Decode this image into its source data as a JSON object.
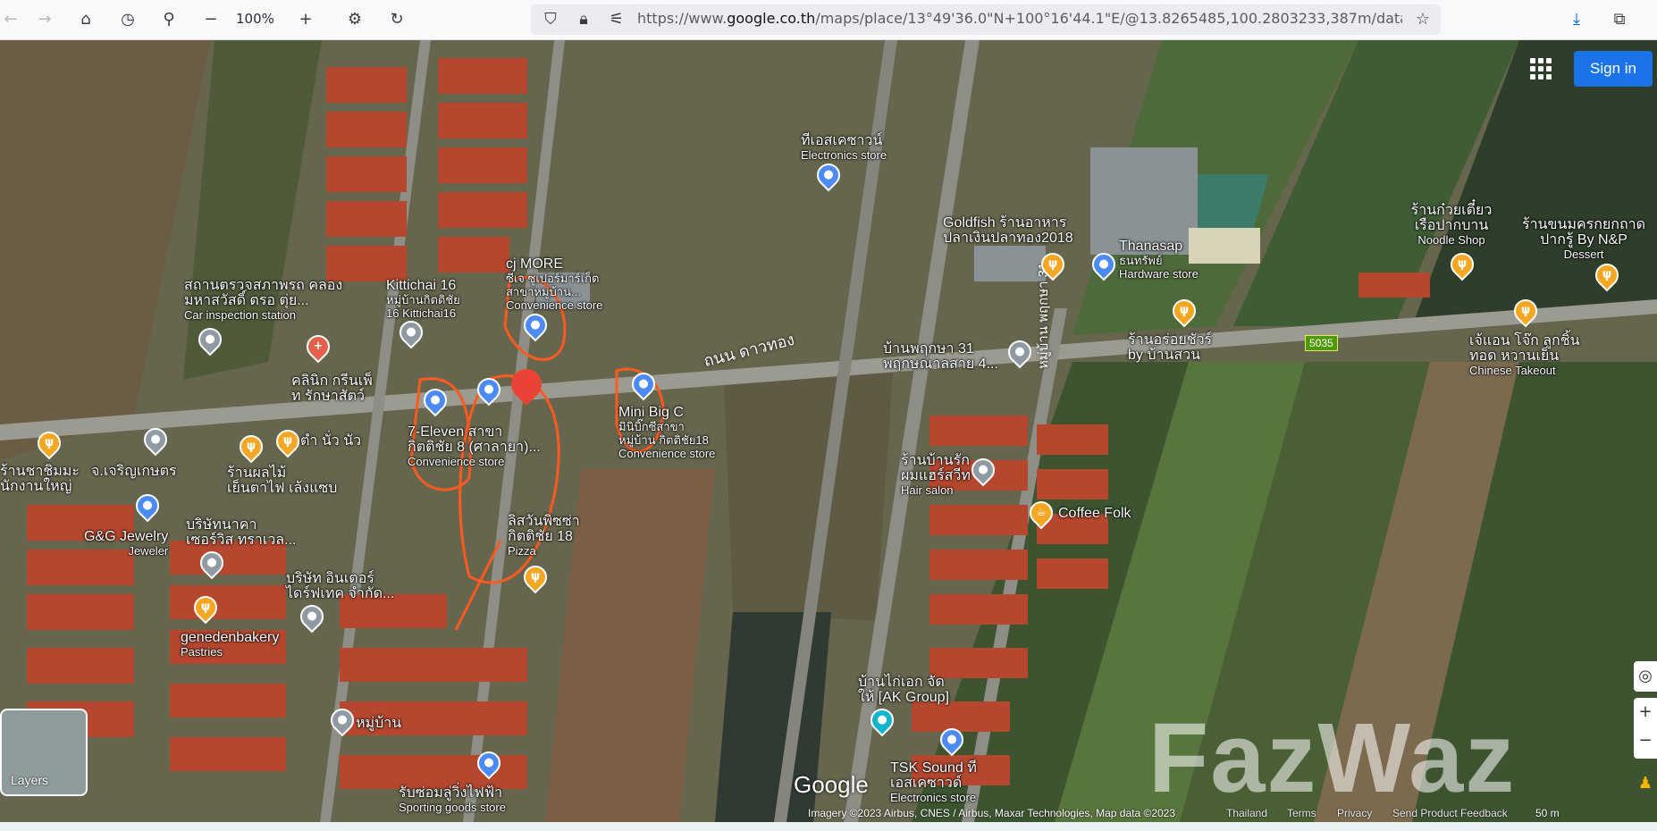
{
  "browser": {
    "zoom": "100%",
    "url_prefix": "https://www.",
    "url_domain": "google.co.th",
    "url_rest": "/maps/place/13°49'36.0\"N+100°16'44.1\"E/@13.8265485,100.2803233,387m/data"
  },
  "map": {
    "sign_in": "Sign in",
    "layers": "Layers",
    "google": "Google",
    "road_main": "ถนน ดาวทอง",
    "road_side": "หมู่บ้าน พฤกษา 31",
    "route_badge": "5035",
    "watermark": "FazWaz",
    "footer": {
      "imagery": "Imagery ©2023 Airbus, CNES / Airbus, Maxar Technologies, Map data ©2023",
      "thailand": "Thailand",
      "terms": "Terms",
      "privacy": "Privacy",
      "feedback": "Send Product Feedback",
      "scale": "50 m"
    },
    "places": [
      {
        "name": "ทีเอสเคซาวน์",
        "sub": "Electronics store"
      },
      {
        "name": "Goldfish ร้านอาหาร",
        "name2": "ปลาเงินปลาทอง2018"
      },
      {
        "name": "Thanasap",
        "name2": "ธนทรัพย์",
        "sub": "Hardware store"
      },
      {
        "name": "ร้านก๋วยเตี๋ยว",
        "name2": "เรือปากบาน",
        "sub": "Noodle Shop"
      },
      {
        "name": "ร้านขนมครกยกถาด",
        "name2": "ปากรู้ By N&P",
        "sub": "Dessert"
      },
      {
        "name": "สถานตรวจสภาพรถ คลอง",
        "name2": "มหาสวัสดิ์ ตรอ ตุ่ย...",
        "sub": "Car inspection station"
      },
      {
        "name": "Kittichai 16",
        "name2": "หมู่บ้านกิตติชัย",
        "name3": "16 Kittichai16"
      },
      {
        "name": "cj MORE",
        "name2": "ซีเจ ซูเปอร์มาร์เก็ต",
        "name3": "สาขาหมู่บ้าน...",
        "sub": "Convenience store"
      },
      {
        "name": "บ้านพฤกษา 31",
        "name2": "พฤกษณาลสาย 4..."
      },
      {
        "name": "ร้านอร่อยชัวร์",
        "name2": "by บ้านสวน"
      },
      {
        "name": "เจ้แอน โจ๊ก ลูกชิ้น",
        "name2": "ทอด หวานเย็น",
        "sub": "Chinese Takeout"
      },
      {
        "name": "คลินิก กรีนเพ็",
        "name2": "ท รักษาสัตว์"
      },
      {
        "name": "Mini Big C",
        "name2": "มินิบิ๊กซีสาขา",
        "name3": "หมู่บ้าน กิตติชัย18",
        "sub": "Convenience store"
      },
      {
        "name": "7-Eleven สาขา",
        "name2": "กิตติชัย 8 (ศาลายา)...",
        "sub": "Convenience store"
      },
      {
        "name": "ตำ นั่ว นัว"
      },
      {
        "name": "ร้านชาชิมมะ",
        "name2": "นักงานใหญ่"
      },
      {
        "name": "จ.เจริญเกษตร"
      },
      {
        "name": "ร้านผลไม้",
        "name2": "เย็นตาไฟ เล้งแซบ"
      },
      {
        "name": "ร้านบ้านรัก",
        "name2": "ผมแฮร์สวีท",
        "sub": "Hair salon"
      },
      {
        "name": "Coffee Folk"
      },
      {
        "name": "G&G Jewelry",
        "sub": "Jeweler"
      },
      {
        "name": "บริษัทนาคา",
        "name2": "เซอร์วิส ทราเวล..."
      },
      {
        "name": "ลิสวันพิซซ่า",
        "name2": "กิตติชัย 18",
        "sub": "Pizza"
      },
      {
        "name": "บริษัท อินเตอร์",
        "name2": "ไดร์ฟเทค จำกัด..."
      },
      {
        "name": "genedenbakery",
        "sub": "Pastries"
      },
      {
        "name": "หมู่บ้าน"
      },
      {
        "name": "บ้านไก่เอก จัด",
        "name2": "ให้ [AK Group]"
      },
      {
        "name": "TSK Sound ที",
        "name2": "เอสเคซาวด์",
        "sub": "Electronics store"
      },
      {
        "name": "รับซ่อมลู่วิ่งไฟฟ้า",
        "sub": "Sporting goods store"
      }
    ]
  }
}
